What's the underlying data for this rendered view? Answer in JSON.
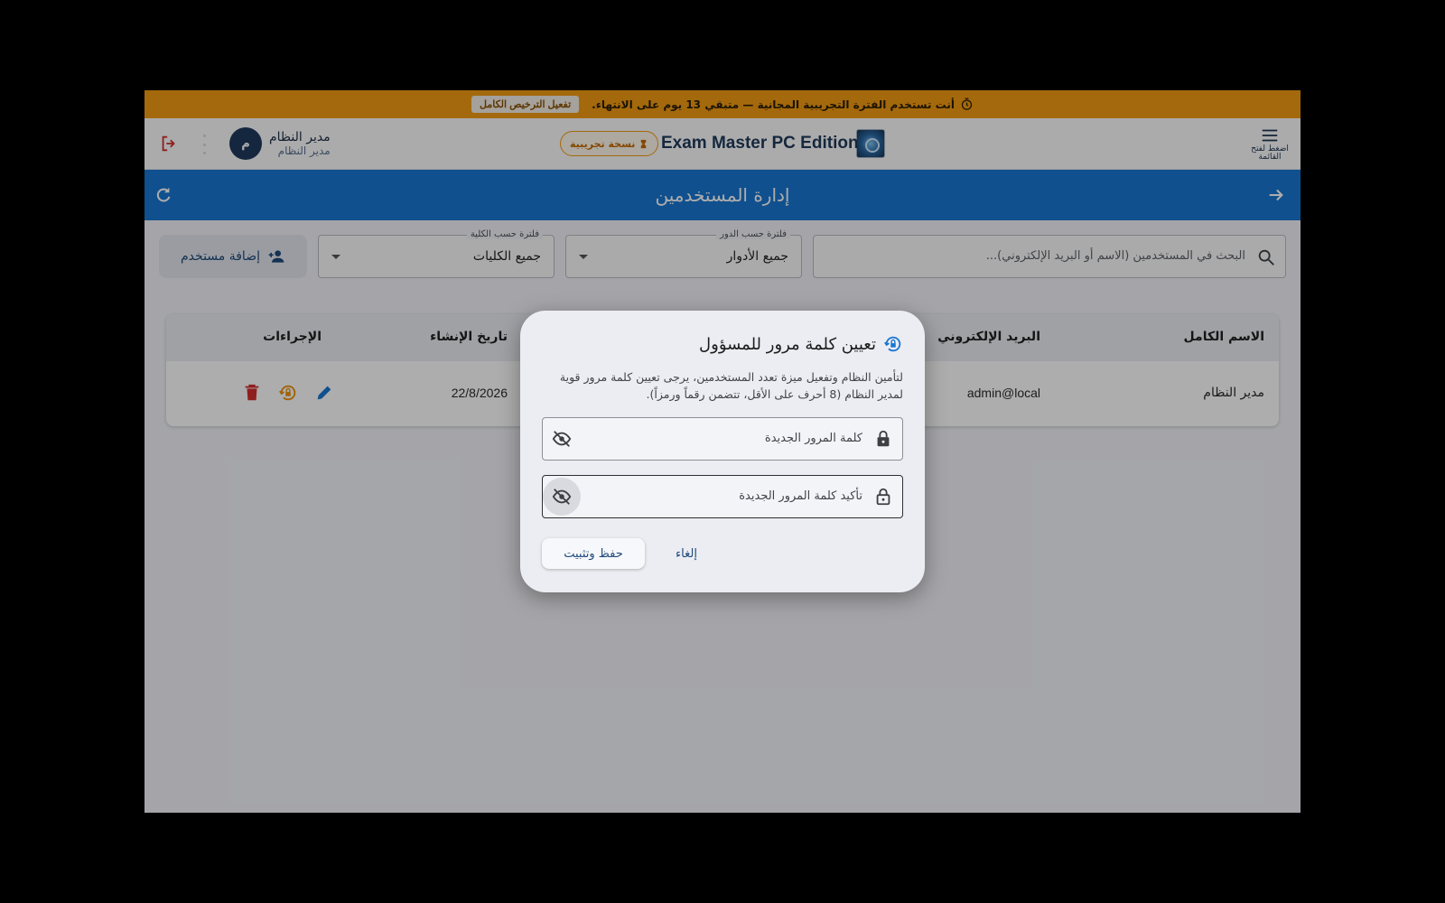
{
  "trial_banner": {
    "message": "أنت تستخدم الفترة التجريبية المجانية — متبقي 13 يوم على الانتهاء.",
    "activate_label": "تفعيل الترخيص الكامل"
  },
  "topbar": {
    "menu_label": "اضغط لفتح القائمة",
    "app_title": "Exam Master PC Edition",
    "trial_chip": "نسخة تجريبية",
    "user_name": "مدير النظام",
    "user_role": "مدير النظام",
    "avatar_initial": "م"
  },
  "page": {
    "title": "إدارة المستخدمين"
  },
  "filters": {
    "search_placeholder": "البحث في المستخدمين (الاسم أو البريد الإلكتروني)...",
    "role_label": "فلترة حسب الدور",
    "role_value": "جميع الأدوار",
    "college_label": "فلترة حسب الكلية",
    "college_value": "جميع الكليات",
    "add_user_label": "إضافة مستخدم"
  },
  "table": {
    "columns": {
      "full_name": "الاسم الكامل",
      "email": "البريد الإلكتروني",
      "created": "تاريخ الإنشاء",
      "actions": "الإجراءات"
    },
    "rows": [
      {
        "full_name": "مدير النظام",
        "email": "admin@local",
        "created": "22/8/2026"
      }
    ]
  },
  "dialog": {
    "title": "تعيين كلمة مرور للمسؤول",
    "description": "لتأمين النظام وتفعيل ميزة تعدد المستخدمين، يرجى تعيين كلمة مرور قوية لمدير النظام (8 أحرف على الأقل، تتضمن رقماً ورمزاً).",
    "new_password_placeholder": "كلمة المرور الجديدة",
    "confirm_password_placeholder": "تأكيد كلمة المرور الجديدة",
    "save_label": "حفظ وتثبيت",
    "cancel_label": "إلغاء"
  },
  "colors": {
    "banner": "#f29b12",
    "header": "#1976d2",
    "danger": "#d32f2f",
    "warning": "#ef8f00",
    "primary": "#1976d2"
  }
}
